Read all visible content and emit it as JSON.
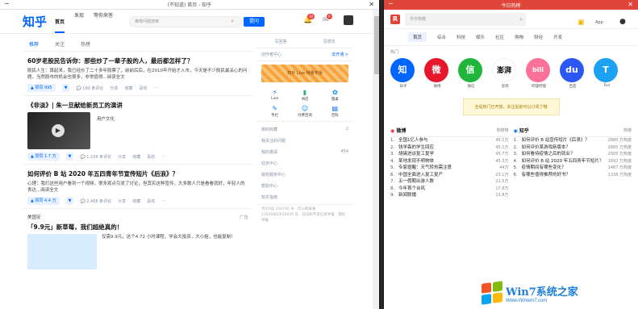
{
  "left_window": {
    "title": "(不知道) 首页 - 知乎",
    "logo": "知乎",
    "nav": [
      "首页",
      "发现",
      "等你来答"
    ],
    "search_placeholder": "推荐问题搜索",
    "ask_button": "提问",
    "bell_badge": "30",
    "msg_badge": "9",
    "feed_tabs": [
      "推荐",
      "关注",
      "热榜"
    ],
    "cards": [
      {
        "title": "60岁老股民告诉你：那些炒了一辈子股的人，最后都怎样了？",
        "excerpt": "股民人生：算起来，我已经炒了二十多年股票了，前前后后，在2010年开始才入市，今天是不少股民最关心的问题，当然股市的机会也很多，非常值得...阅读全文",
        "vote": "赞同 995",
        "comments": "190 条评论",
        "share": "分享",
        "fav": "收藏",
        "like": "喜欢"
      },
      {
        "title": "《非淡》| 朱一旦献给新员工的演讲",
        "author": "用户文化",
        "vote": "赞同 1.7 万",
        "comments": "1,106 条评论",
        "share": "分享",
        "fav": "收藏",
        "like": "喜欢"
      },
      {
        "title": "如何评价 B 站 2020 年五四青年节宣传短片《后浪》？",
        "excerpt": "心理：我们这些用户看到一个视频，很多观点引发了讨论，但其实这种宣传，大多数人只是看看就好，年轻人的表达...阅读全文",
        "vote": "赞同 4.4 万",
        "comments": "2,468 条评论",
        "share": "分享",
        "fav": "收藏",
        "like": "喜欢"
      },
      {
        "brand": "美国安",
        "title": "「9.9元」新草莓，我们超绝真的！",
        "excerpt": "仅需9.9元，这个4.72 小时课程，学会大投资，大小姐，也能复制！",
        "vote": "",
        "ad_tag": "广告"
      }
    ],
    "side": {
      "tabs": [
        "写回答",
        "写想法"
      ],
      "creator": "创作者中心",
      "creator_action": "去开通 >",
      "promo": "知乎 Live 特惠专场",
      "features": [
        "Live",
        "书店",
        "圆桌",
        "专栏",
        "付费咨询",
        "百科"
      ],
      "list": [
        {
          "label": "我的收藏",
          "count": "2"
        },
        {
          "label": "我关注的问题",
          "count": ""
        },
        {
          "label": "我的邀请",
          "count": "454"
        },
        {
          "label": "站务中心",
          "count": ""
        },
        {
          "label": "版权服务中心",
          "count": ""
        },
        {
          "label": "帮助中心",
          "count": ""
        },
        {
          "label": "知乎指南",
          "count": ""
        }
      ],
      "footer": "京ICP证 110745 号 · 京公网安备 11010802010035 号 · 违法和不良信息举报 · 侵权举报"
    }
  },
  "right_window": {
    "title": "今日热榜",
    "logo_letter": "R",
    "search_placeholder": "今日热榜",
    "tabs": [
      "首页",
      "综合",
      "科技",
      "娱乐",
      "社区",
      "购物",
      "财经",
      "开发"
    ],
    "section": "热门",
    "apps": [
      {
        "name": "知乎",
        "label": "知",
        "color": "#0066ff"
      },
      {
        "name": "微博",
        "label": "微",
        "color": "#e6162d"
      },
      {
        "name": "微信",
        "label": "信",
        "color": "#20b63c"
      },
      {
        "name": "澎湃",
        "label": "澎湃",
        "color": "#ffffff"
      },
      {
        "name": "哔哩哔哩",
        "label": "bili",
        "color": "#fb7299"
      },
      {
        "name": "百度",
        "label": "du",
        "color": "#2b58f5"
      },
      {
        "name": "Tod",
        "label": "T",
        "color": "#1da1f2"
      }
    ],
    "notice": "全站热门已开放，关注后就可以订阅了哦",
    "weibo": {
      "name": "微博",
      "label": "热搜榜",
      "items": [
        {
          "t": "全国1亿人参与",
          "v": "46.1万"
        },
        {
          "t": "钱学森的学生回应",
          "v": "45.1万"
        },
        {
          "t": "胡锡进谈复工复学",
          "v": "45.7万"
        },
        {
          "t": "某地发现不明物体",
          "v": "45.3万"
        },
        {
          "t": "专家提醒：天气转热需注意",
          "v": "44万"
        },
        {
          "t": "中国全面进入复工复产",
          "v": "23.1万"
        },
        {
          "t": "五一假期出游人数",
          "v": "21.5万"
        },
        {
          "t": "今年首个台风",
          "v": "17.8万"
        },
        {
          "t": "新闻联播",
          "v": "13.8万"
        }
      ]
    },
    "zhihu": {
      "name": "知乎",
      "label": "热榜",
      "items": [
        {
          "t": "如何评价 B 站宣传短片《后浪》？",
          "v": "2880 万热度"
        },
        {
          "t": "如何评价某游戏新版本？",
          "v": "2885 万热度"
        },
        {
          "t": "如何看待疫情之后的就业？",
          "v": "2005 万热度"
        },
        {
          "t": "如何评价 B 站 2020 年五四青年节短片？",
          "v": "1692 万热度"
        },
        {
          "t": "疫情期间有哪些变化？",
          "v": "1467 万热度"
        },
        {
          "t": "有哪些值得推荐的好书？",
          "v": "1338 万热度"
        }
      ]
    },
    "watermark": {
      "text": "Win7系统之家",
      "url": "Www.Winwin7.com"
    }
  },
  "colors": {
    "zhihu_blue": "#0066ff",
    "jr_red": "#e0453a"
  }
}
